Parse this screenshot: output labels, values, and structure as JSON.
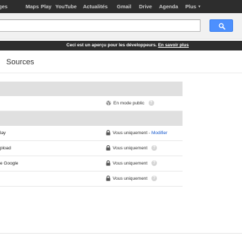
{
  "nav": {
    "items": [
      {
        "label": "ges"
      },
      {
        "label": "Maps"
      },
      {
        "label": "Play"
      },
      {
        "label": "YouTube"
      },
      {
        "label": "Actualités"
      },
      {
        "label": "Gmail"
      },
      {
        "label": "Drive"
      },
      {
        "label": "Agenda"
      },
      {
        "label": "Plus"
      }
    ]
  },
  "search": {
    "value": "",
    "button_icon": "search-icon",
    "button_color": "#4d90fe"
  },
  "banner": {
    "message": "Ceci est un aperçu pour les développeurs.",
    "link_label": "En savoir plus"
  },
  "page": {
    "title": "Sources"
  },
  "table": {
    "rows": [
      {
        "name": "",
        "status": "En mode public",
        "status_icon": "globe-icon",
        "edit": ""
      },
      {
        "name": "lay",
        "status": "Vous uniquement",
        "status_icon": "lock-icon",
        "edit": "Modifier"
      },
      {
        "name": "pload",
        "status": "Vous uniquement",
        "status_icon": "lock-icon",
        "edit": ""
      },
      {
        "name": "e Google",
        "status": "Vous uniquement",
        "status_icon": "lock-icon",
        "edit": ""
      },
      {
        "name": "",
        "status": "Vous uniquement",
        "status_icon": "lock-icon",
        "edit": ""
      }
    ],
    "separator": " - ",
    "help_glyph": "?"
  }
}
